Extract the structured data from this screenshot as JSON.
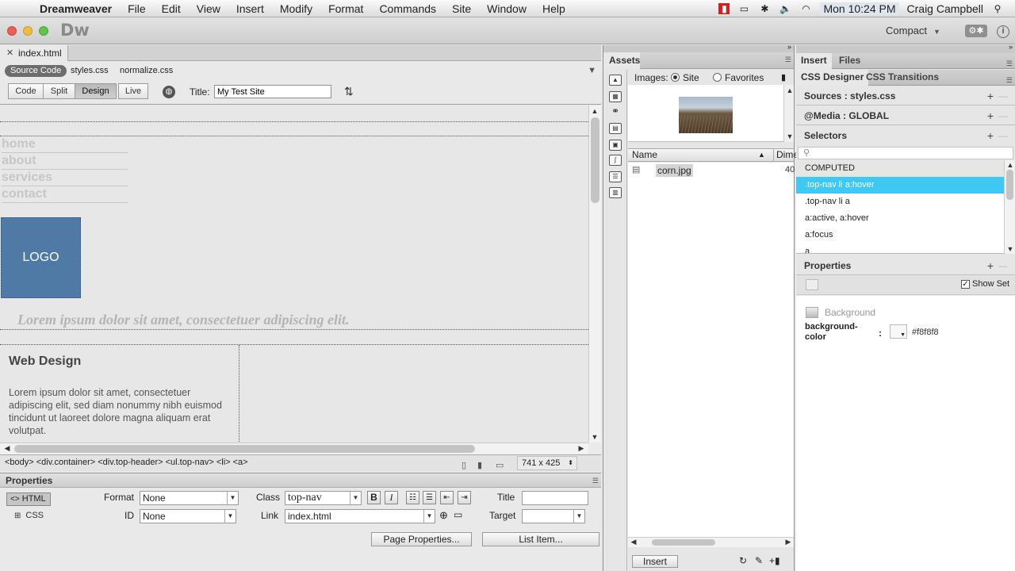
{
  "menubar": {
    "app": "Dreamweaver",
    "items": [
      "File",
      "Edit",
      "View",
      "Insert",
      "Modify",
      "Format",
      "Commands",
      "Site",
      "Window",
      "Help"
    ],
    "clock": "Mon 10:24 PM",
    "user": "Craig Campbell"
  },
  "app": {
    "logo": "Dw",
    "workspace": "Compact"
  },
  "document": {
    "tab": "index.html",
    "related": {
      "source": "Source Code",
      "files": [
        "styles.css",
        "normalize.css"
      ]
    },
    "views": [
      "Code",
      "Split",
      "Design",
      "Live"
    ],
    "active_view": "Design",
    "title_label": "Title:",
    "title_value": "My Test Site"
  },
  "canvas": {
    "nav": [
      "home",
      "about",
      "services",
      "contact"
    ],
    "logo": "LOGO",
    "tagline": "Lorem ipsum dolor sit amet, consectetuer adipiscing elit.",
    "section_title": "Web Design",
    "section_body": "Lorem ipsum dolor sit amet, consectetuer adipiscing elit, sed diam nonummy nibh euismod tincidunt ut laoreet dolore magna aliquam erat volutpat."
  },
  "tagbar": {
    "tags": "<body> <div.container> <div.top-header> <ul.top-nav> <li> <a>",
    "size": "741 x 425"
  },
  "properties": {
    "title": "Properties",
    "html": "HTML",
    "css": "CSS",
    "format_label": "Format",
    "format_value": "None",
    "id_label": "ID",
    "id_value": "None",
    "class_label": "Class",
    "class_value": "top-nav",
    "link_label": "Link",
    "link_value": "index.html",
    "title_label": "Title",
    "target_label": "Target",
    "page_props": "Page Properties...",
    "list_item": "List Item..."
  },
  "assets": {
    "tab": "Assets",
    "images_label": "Images:",
    "site": "Site",
    "favorites": "Favorites",
    "col_name": "Name",
    "col_dim": "Dime",
    "file": "corn.jpg",
    "file_dim": "40",
    "insert": "Insert"
  },
  "css_designer": {
    "top_tabs": [
      "Insert",
      "Files"
    ],
    "tabs": [
      "CSS Designer",
      "CSS Transitions"
    ],
    "sources": "Sources :  styles.css",
    "media": "@Media :  GLOBAL",
    "selectors": "Selectors",
    "selector_items": [
      "COMPUTED",
      ".top-nav li a:hover",
      ".top-nav li a",
      "a:active, a:hover",
      "a:focus",
      "a"
    ],
    "properties": "Properties",
    "show_set": "Show Set",
    "bg_group": "Background",
    "bg_prop": "background-color",
    "bg_colon": ":",
    "bg_value": "#f8f8f8"
  },
  "colors": {
    "accent": "#3ec8f2",
    "logo_block": "#4f7aa6"
  }
}
